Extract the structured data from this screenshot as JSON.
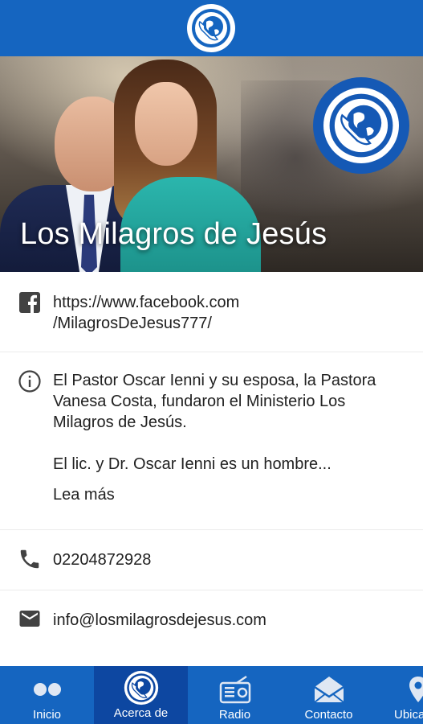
{
  "header": {
    "logo_icon": "globe-phone-logo-icon",
    "color": "#1565c0"
  },
  "hero": {
    "title": "Los Milagros de Jesús",
    "badge_icon": "globe-phone-logo-icon"
  },
  "facebook": {
    "icon": "facebook-icon",
    "url_line1": "https://www.facebook.com",
    "url_line2": "/MilagrosDeJesus777/"
  },
  "about": {
    "icon": "info-icon",
    "line1": "El Pastor Oscar Ienni y su esposa, la Pastora",
    "line2": "Vanesa Costa, fundaron el Ministerio Los",
    "line3": "Milagros de Jesús.",
    "line4": "El lic. y Dr. Oscar Ienni es un hombre...",
    "more_label": "Lea más",
    "more_color": "#e6620f"
  },
  "phone": {
    "icon": "phone-icon",
    "number": "02204872928"
  },
  "email": {
    "icon": "email-icon",
    "address": "info@losmilagrosdejesus.com"
  },
  "bottom_nav": {
    "items": [
      {
        "label": "Inicio",
        "icon": "home-dots-icon",
        "active": false
      },
      {
        "label": "Acerca de",
        "icon": "globe-phone-logo-icon",
        "active": true
      },
      {
        "label": "Radio",
        "icon": "radio-icon",
        "active": false
      },
      {
        "label": "Contacto",
        "icon": "envelope-icon",
        "active": false
      },
      {
        "label": "Ubica",
        "icon": "location-pin-icon",
        "active": false
      }
    ]
  }
}
